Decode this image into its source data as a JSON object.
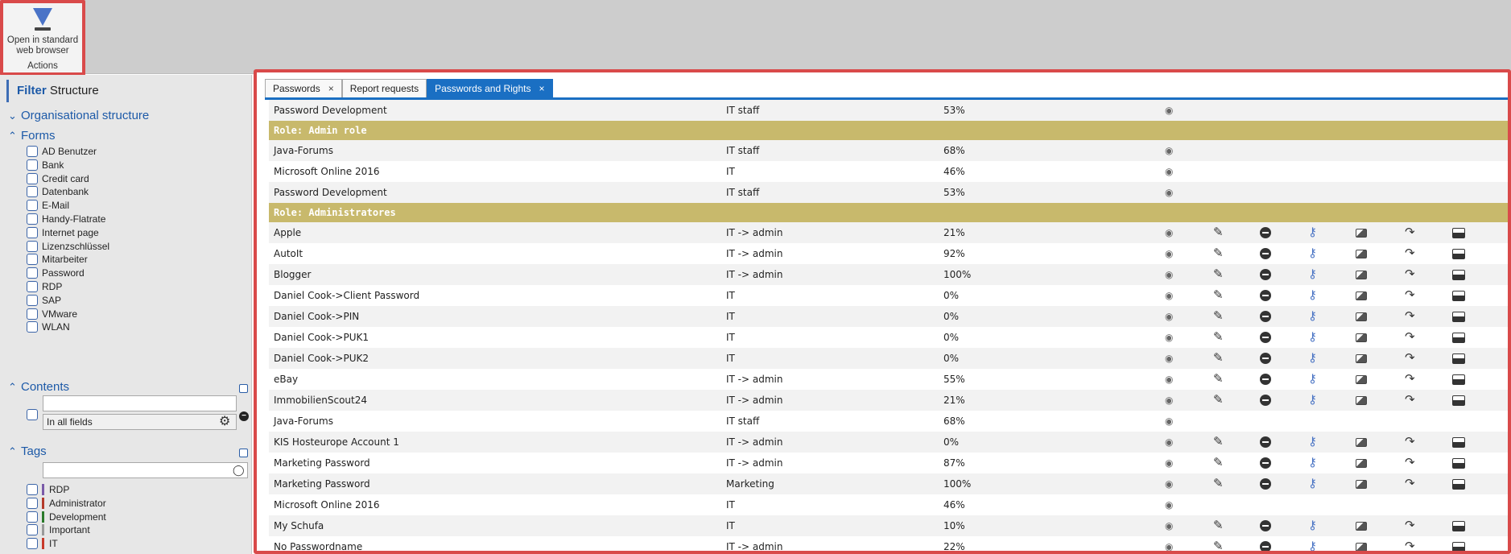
{
  "ribbon": {
    "action_label": "Open in standard\nweb browser",
    "group_label": "Actions"
  },
  "sidebar": {
    "header_filter": "Filter",
    "header_structure": "Structure",
    "sections": {
      "organisational": "Organisational structure",
      "forms": "Forms",
      "contents": "Contents",
      "tags": "Tags"
    },
    "forms": [
      "AD Benutzer",
      "Bank",
      "Credit card",
      "Datenbank",
      "E-Mail",
      "Handy-Flatrate",
      "Internet page",
      "Lizenzschlüssel",
      "Mitarbeiter",
      "Password",
      "RDP",
      "SAP",
      "VMware",
      "WLAN"
    ],
    "contents_select": "In all fields",
    "tags": [
      {
        "label": "RDP",
        "color": "#7a5aa8"
      },
      {
        "label": "Administrator",
        "color": "#b43a2a"
      },
      {
        "label": "Development",
        "color": "#2a7a2a"
      },
      {
        "label": "Important",
        "color": "#9a9a9a"
      },
      {
        "label": "IT",
        "color": "#c83a2a"
      }
    ]
  },
  "tabs": [
    {
      "label": "Passwords",
      "closable": true,
      "active": false
    },
    {
      "label": "Report requests",
      "closable": false,
      "active": false
    },
    {
      "label": "Passwords and Rights",
      "closable": true,
      "active": true
    }
  ],
  "close_glyph": "×",
  "rows": [
    {
      "type": "data",
      "name": "Password Development",
      "folder": "IT staff",
      "pct": "53%",
      "full": false
    },
    {
      "type": "role",
      "label": "Role: Admin role"
    },
    {
      "type": "data",
      "name": "Java-Forums",
      "folder": "IT staff",
      "pct": "68%",
      "full": false
    },
    {
      "type": "data",
      "name": "Microsoft Online 2016",
      "folder": "IT",
      "pct": "46%",
      "full": false
    },
    {
      "type": "data",
      "name": "Password Development",
      "folder": "IT staff",
      "pct": "53%",
      "full": false
    },
    {
      "type": "role",
      "label": "Role: Administratores"
    },
    {
      "type": "data",
      "name": "Apple",
      "folder": "IT -> admin",
      "pct": "21%",
      "full": true
    },
    {
      "type": "data",
      "name": "AutoIt",
      "folder": "IT -> admin",
      "pct": "92%",
      "full": true
    },
    {
      "type": "data",
      "name": "Blogger",
      "folder": "IT -> admin",
      "pct": "100%",
      "full": true
    },
    {
      "type": "data",
      "name": "Daniel Cook->Client Password",
      "folder": "IT",
      "pct": "0%",
      "full": true
    },
    {
      "type": "data",
      "name": "Daniel Cook->PIN",
      "folder": "IT",
      "pct": "0%",
      "full": true
    },
    {
      "type": "data",
      "name": "Daniel Cook->PUK1",
      "folder": "IT",
      "pct": "0%",
      "full": true
    },
    {
      "type": "data",
      "name": "Daniel Cook->PUK2",
      "folder": "IT",
      "pct": "0%",
      "full": true
    },
    {
      "type": "data",
      "name": "eBay",
      "folder": "IT -> admin",
      "pct": "55%",
      "full": true
    },
    {
      "type": "data",
      "name": "ImmobilienScout24",
      "folder": "IT -> admin",
      "pct": "21%",
      "full": true
    },
    {
      "type": "data",
      "name": "Java-Forums",
      "folder": "IT staff",
      "pct": "68%",
      "full": false
    },
    {
      "type": "data",
      "name": "KIS Hosteurope Account 1",
      "folder": "IT -> admin",
      "pct": "0%",
      "full": true
    },
    {
      "type": "data",
      "name": "Marketing Password",
      "folder": "IT -> admin",
      "pct": "87%",
      "full": true
    },
    {
      "type": "data",
      "name": "Marketing Password",
      "folder": "Marketing",
      "pct": "100%",
      "full": true
    },
    {
      "type": "data",
      "name": "Microsoft Online 2016",
      "folder": "IT",
      "pct": "46%",
      "full": false
    },
    {
      "type": "data",
      "name": "My Schufa",
      "folder": "IT",
      "pct": "10%",
      "full": true
    },
    {
      "type": "data",
      "name": "No Passwordname",
      "folder": "IT -> admin",
      "pct": "22%",
      "full": true
    }
  ],
  "icons": {
    "view": "eye-icon",
    "edit": "pencil-icon",
    "remove": "minus-circle-icon",
    "key": "key-icon",
    "image": "image-icon",
    "move": "move-icon",
    "print": "printer-icon"
  },
  "colors": {
    "accent": "#1a6fc3",
    "role_row": "#c8b96c",
    "highlight": "#d94a4a"
  }
}
